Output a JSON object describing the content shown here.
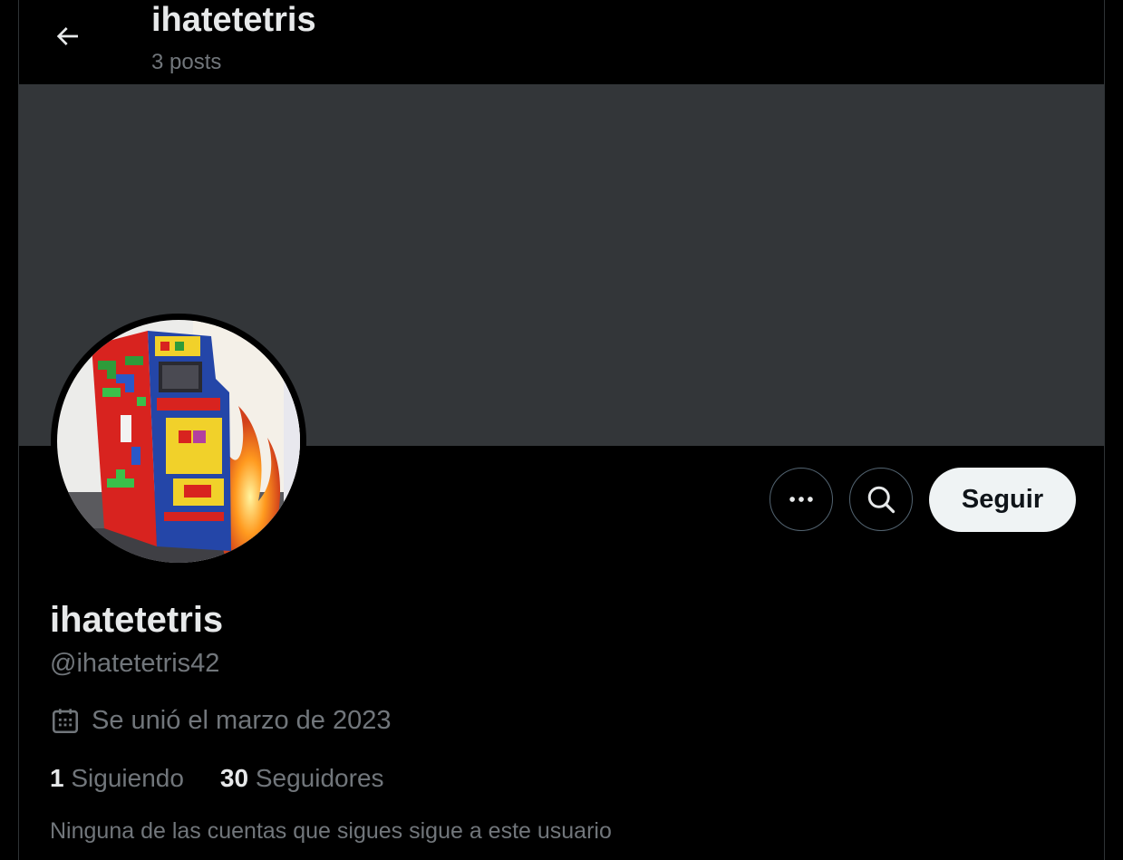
{
  "header": {
    "title": "ihatetetris",
    "posts": "3 posts"
  },
  "profile": {
    "display_name": "ihatetetris",
    "handle": "@ihatetetris42",
    "joined": "Se unió el marzo de 2023",
    "following_count": "1",
    "following_label": "Siguiendo",
    "followers_count": "30",
    "followers_label": "Seguidores",
    "mutual_note": "Ninguna de las cuentas que sigues sigue a este usuario"
  },
  "actions": {
    "follow_label": "Seguir"
  },
  "icons": {
    "back": "arrow-left-icon",
    "more": "more-horizontal-icon",
    "search": "search-icon",
    "calendar": "calendar-icon"
  },
  "colors": {
    "background": "#000000",
    "banner": "#333639",
    "text_primary": "#e7e9ea",
    "text_secondary": "#71767b",
    "follow_button_bg": "#eff3f4",
    "border": "#2f3336"
  }
}
